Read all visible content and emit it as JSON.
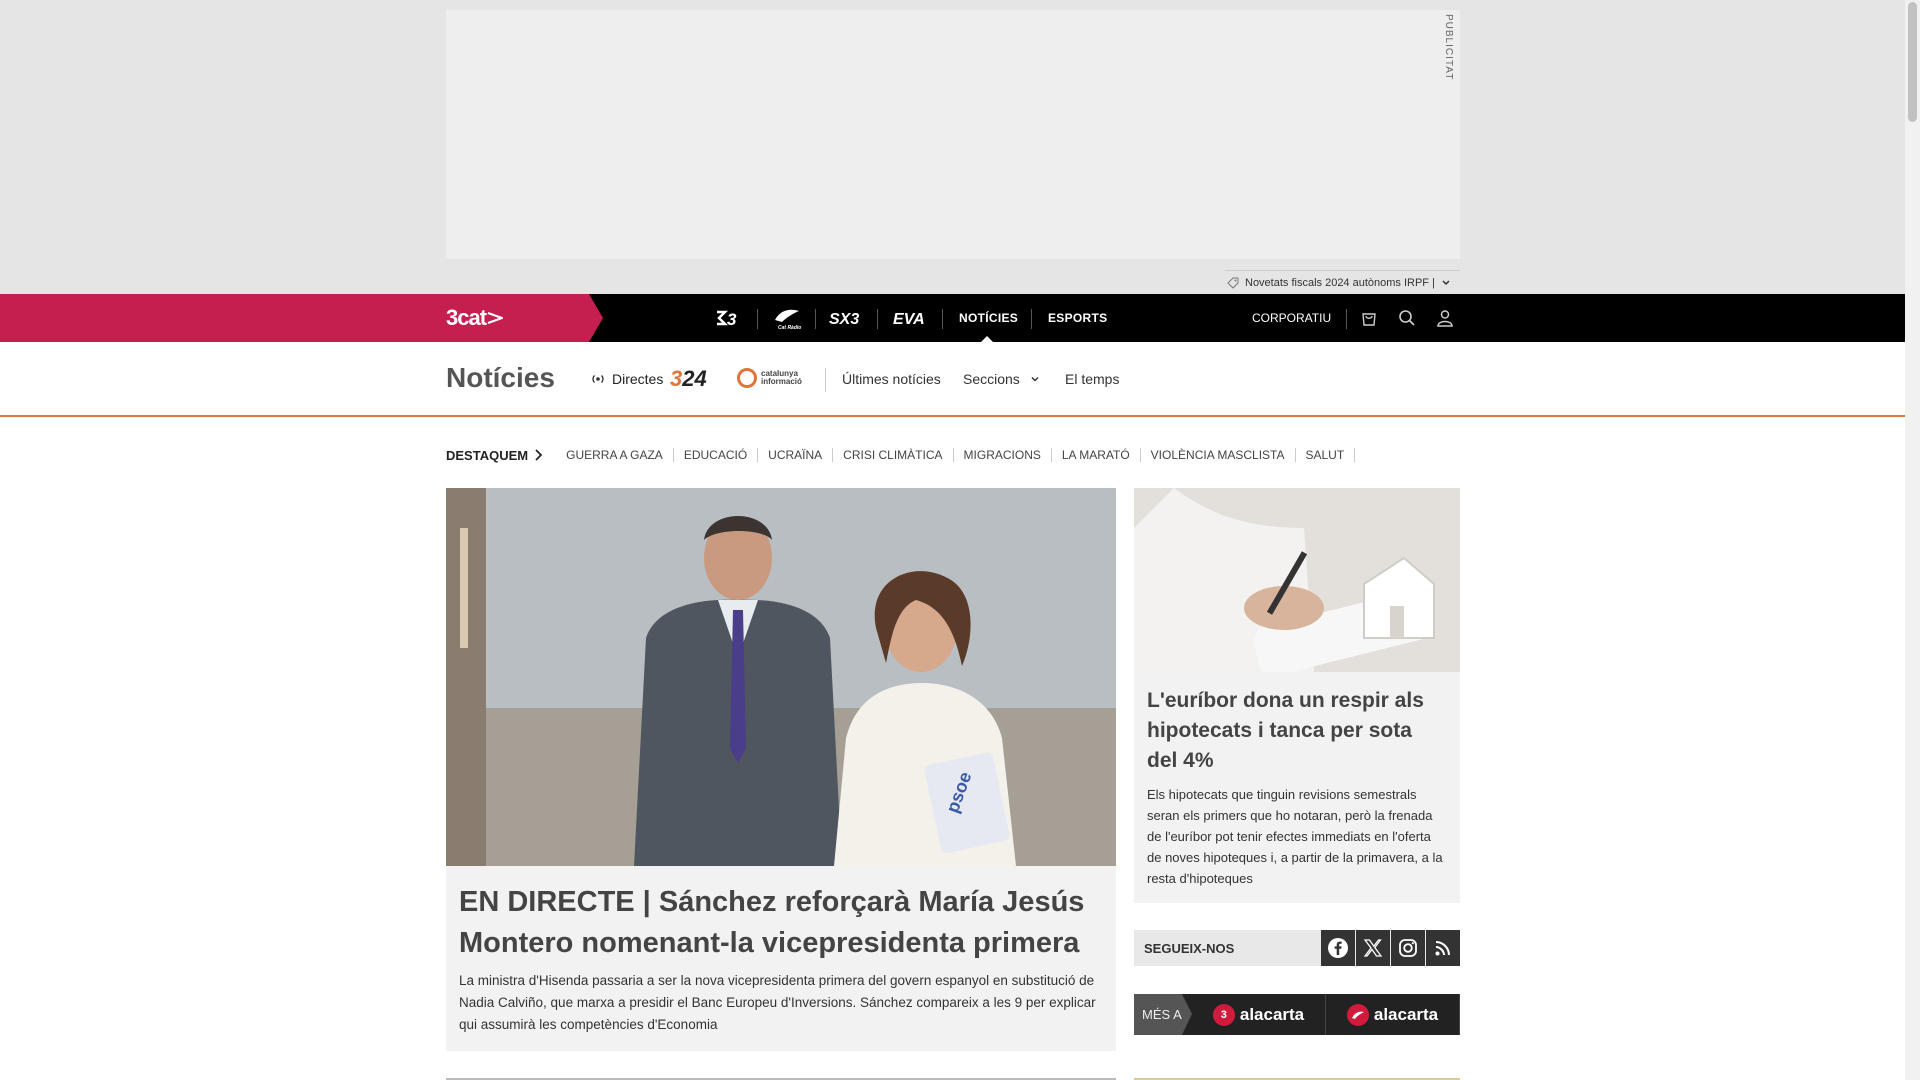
{
  "ad": {
    "label": "PUBLICITAT",
    "ticker_text": "Novetats fiscals 2024 autònoms IRPF |"
  },
  "topnav": {
    "brand": "3cat",
    "channels": [
      {
        "name": "3-logo-icon",
        "text": "3"
      },
      {
        "name": "catradio-logo-icon",
        "text": "Cat Ràdio"
      },
      {
        "name": "sx3-logo-icon",
        "text": "SX3"
      },
      {
        "name": "eva-logo-icon",
        "text": "EVA"
      }
    ],
    "noticies": "NOTÍCIES",
    "esports": "ESPORTS",
    "corporatiu": "CORPORATIU"
  },
  "section": {
    "title": "Notícies",
    "directes": "Directes",
    "logo_324": "324",
    "catinfo": "catalunya informació",
    "ultimes": "Últimes notícies",
    "seccions": "Seccions",
    "temps": "El temps"
  },
  "highlights": {
    "label": "DESTAQUEM",
    "items": [
      "GUERRA A GAZA",
      "EDUCACIÓ",
      "UCRAÏNA",
      "CRISI CLIMÀTICA",
      "MIGRACIONS",
      "LA MARATÓ",
      "VIOLÈNCIA MASCLISTA",
      "SALUT"
    ]
  },
  "main_story": {
    "title": "EN DIRECTE | Sánchez reforçarà María Jesús Montero nomenant-la vicepresidenta primera",
    "summary": "La ministra d'Hisenda passaria a ser la nova vicepresidenta primera del govern espanyol en substitució de Nadia Calviño, que marxa a presidir el Banc Europeu d'Inversions. Sánchez compareix a les 9 per explicar qui assumirà les competències d'Economia"
  },
  "side_story": {
    "title": "L'euríbor dona un respir als hipotecats i tanca per sota del 4%",
    "summary": "Els hipotecats que tinguin revisions semestrals seran els primers que ho notaran, però la frenada de l'euríbor pot tenir efectes immediats en l'oferta de noves hipoteques i, a partir de la primavera, a la resta d'hipoteques"
  },
  "follow": {
    "label": "SEGUEIX-NOS",
    "networks": [
      "facebook-icon",
      "x-icon",
      "instagram-icon",
      "rss-icon"
    ]
  },
  "mesa": {
    "label": "MÉS A",
    "items": [
      {
        "badge": "3",
        "text": "alacarta"
      },
      {
        "badge": "",
        "text": "alacarta"
      }
    ]
  },
  "colors": {
    "brand_red": "#c41f4e",
    "topbar_black": "#000000",
    "accent_orange": "#e0753a"
  }
}
